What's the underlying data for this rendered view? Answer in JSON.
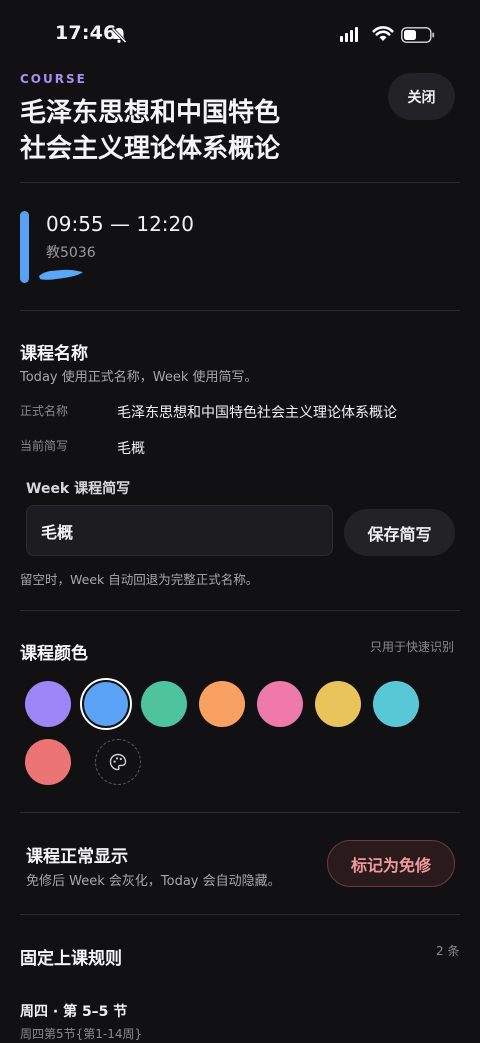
{
  "status_bar": {
    "time": "17:46"
  },
  "header": {
    "tag": "COURSE",
    "title_line1": "毛泽东思想和中国特色",
    "title_line2": "社会主义理论体系概论",
    "close_label": "关闭"
  },
  "session": {
    "time_range": "09:55 — 12:20",
    "room": "教5036",
    "bar_color": "#5aa0f5"
  },
  "course_name": {
    "heading": "课程名称",
    "hint": "Today 使用正式名称，Week 使用简写。",
    "formal_key": "正式名称",
    "formal_value": "毛泽东思想和中国特色社会主义理论体系概论",
    "abbr_key": "当前简写",
    "abbr_value": "毛概",
    "week_abbr_label": "Week 课程简写",
    "week_abbr_input": "毛概",
    "save_label": "保存简写",
    "empty_hint": "留空时，Week 自动回退为完整正式名称。"
  },
  "course_color": {
    "heading": "课程颜色",
    "hint": "只用于快速识别",
    "selected_index": 1,
    "swatches": [
      "#9f86f8",
      "#5ba3f7",
      "#4fc49c",
      "#f9a063",
      "#ef7aaa",
      "#e8c45a",
      "#58c7d6",
      "#ec7474"
    ],
    "custom_icon": "palette-icon"
  },
  "display": {
    "heading": "课程正常显示",
    "hint": "免修后 Week 会灰化，Today 会自动隐藏。",
    "exempt_label": "标记为免修"
  },
  "rules": {
    "heading": "固定上课规则",
    "count": "2 条",
    "first_title": "周四 · 第 5–5 节",
    "first_sub": "周四第5节{第1-14周}"
  }
}
